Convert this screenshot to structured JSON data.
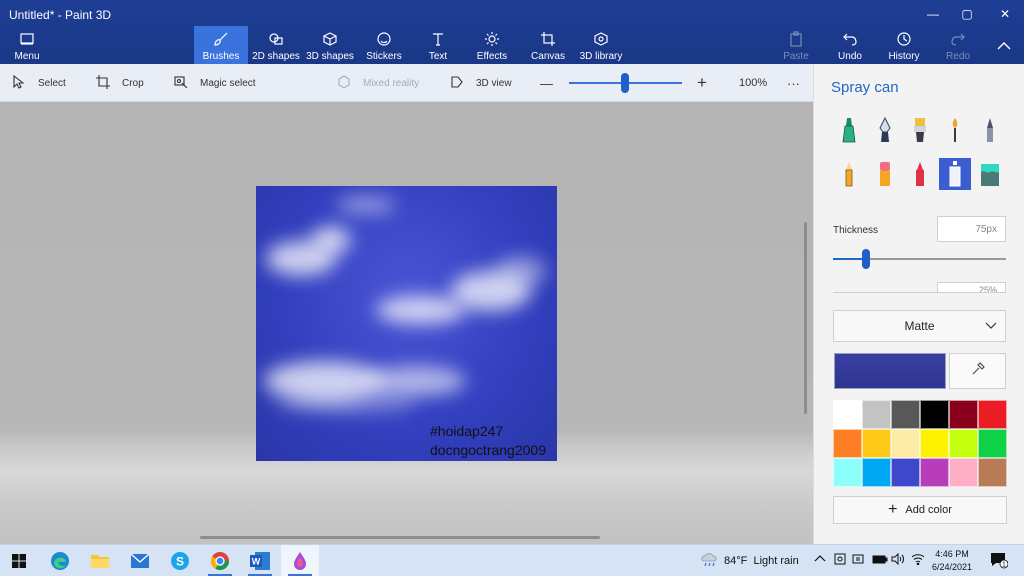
{
  "window": {
    "title": "Untitled* - Paint 3D",
    "controls": {
      "minimize": "—",
      "maximize": "▢",
      "close": "✕"
    }
  },
  "ribbon": {
    "menu_label": "Menu",
    "tabs": [
      {
        "label": "Brushes",
        "icon": "brush-icon",
        "active": true
      },
      {
        "label": "2D shapes",
        "icon": "2d-shapes-icon"
      },
      {
        "label": "3D shapes",
        "icon": "3d-shapes-icon"
      },
      {
        "label": "Stickers",
        "icon": "stickers-icon"
      },
      {
        "label": "Text",
        "icon": "text-icon"
      },
      {
        "label": "Effects",
        "icon": "effects-icon"
      },
      {
        "label": "Canvas",
        "icon": "canvas-icon"
      },
      {
        "label": "3D library",
        "icon": "3d-library-icon"
      }
    ],
    "right": [
      {
        "label": "Paste",
        "icon": "paste-icon",
        "disabled": true
      },
      {
        "label": "Undo",
        "icon": "undo-icon"
      },
      {
        "label": "History",
        "icon": "history-icon"
      },
      {
        "label": "Redo",
        "icon": "redo-icon",
        "disabled": true
      }
    ],
    "collapse_icon": "chevron-up-icon",
    "accent": "#3a72de",
    "background": "#1d3c8f"
  },
  "toolbar": {
    "select": "Select",
    "crop": "Crop",
    "magic_select": "Magic select",
    "mixed_reality": "Mixed reality",
    "view_3d": "3D view",
    "zoom_out": "—",
    "zoom_in": "+",
    "zoom": "100%",
    "more": "···"
  },
  "canvas": {
    "watermark_line1": "#hoidap247",
    "watermark_line2": "docngoctrang2009",
    "background_color": "#3340c0"
  },
  "panel": {
    "title": "Spray can",
    "brushes": [
      {
        "name": "marker",
        "icon": "marker-icon"
      },
      {
        "name": "calligraphy-pen",
        "icon": "calligraphy-pen-icon"
      },
      {
        "name": "oil-brush",
        "icon": "oil-brush-icon"
      },
      {
        "name": "watercolor",
        "icon": "watercolor-icon"
      },
      {
        "name": "pixel-pen",
        "icon": "pixel-pen-icon"
      },
      {
        "name": "pencil",
        "icon": "pencil-icon"
      },
      {
        "name": "eraser",
        "icon": "eraser-icon"
      },
      {
        "name": "crayon",
        "icon": "crayon-icon"
      },
      {
        "name": "spray-can",
        "icon": "spray-can-icon",
        "selected": true
      },
      {
        "name": "fill",
        "icon": "fill-bucket-icon"
      }
    ],
    "thickness_label": "Thickness",
    "thickness_value": "75px",
    "thickness_fraction": 0.19,
    "opacity_partial": "25%",
    "finish": "Matte",
    "current_color": "#2e3491",
    "palette": [
      "#ffffff",
      "#c3c3c3",
      "#585858",
      "#000000",
      "#88001b",
      "#ec1c24",
      "#ff7f27",
      "#ffca18",
      "#fdeca6",
      "#fff200",
      "#c4ff0e",
      "#0ed145",
      "#8cfffb",
      "#00a8f3",
      "#3f48cc",
      "#b83dba",
      "#ffaec8",
      "#b97a56"
    ],
    "add_color": "Add color"
  },
  "taskbar": {
    "apps": [
      {
        "name": "windows-start",
        "icon": "windows-icon"
      },
      {
        "name": "edge",
        "icon": "edge-icon"
      },
      {
        "name": "file-explorer",
        "icon": "folder-icon"
      },
      {
        "name": "mail",
        "icon": "mail-icon"
      },
      {
        "name": "skype",
        "icon": "skype-icon"
      },
      {
        "name": "chrome",
        "icon": "chrome-icon"
      },
      {
        "name": "word",
        "icon": "word-icon"
      },
      {
        "name": "paint-3d",
        "icon": "paint-3d-icon",
        "active": true
      }
    ],
    "weather": "84°F  Light rain",
    "time": "4:46 PM",
    "date": "6/24/2021",
    "notifications": "1"
  }
}
